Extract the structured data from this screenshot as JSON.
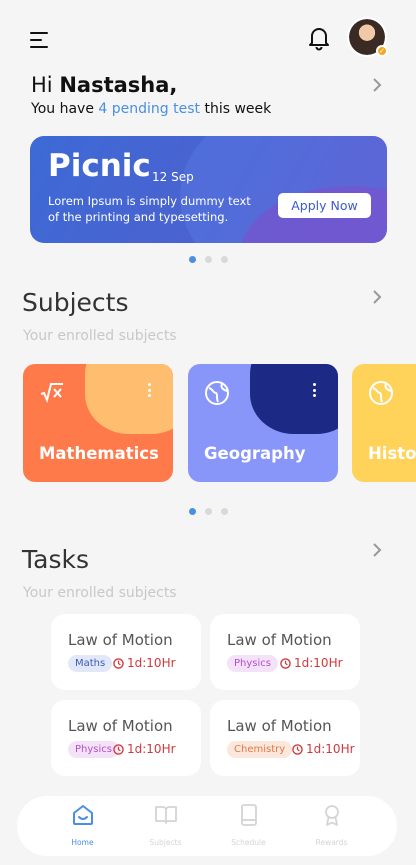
{
  "header": {
    "greeting_prefix": "Hi",
    "user_name": "Nastasha,",
    "pending_prefix": "You have",
    "pending_highlight": "4 pending test",
    "pending_suffix": "this week"
  },
  "banner": {
    "title": "Picnic",
    "date": "12 Sep",
    "description": "Lorem Ipsum is simply dummy text of the printing and typesetting.",
    "button_label": "Apply Now"
  },
  "subjects": {
    "title": "Subjects",
    "subtitle": "Your enrolled subjects",
    "cards": [
      {
        "label": "Mathematics",
        "icon": "square-root-icon",
        "color": "#ff7a4a",
        "corner": "#ffbd70"
      },
      {
        "label": "Geography",
        "icon": "globe-icon",
        "color": "#8896fa",
        "corner": "#1d2a85"
      },
      {
        "label": "History",
        "icon": "globe-icon",
        "color": "#ffd25a",
        "corner": "#ffd25a"
      }
    ]
  },
  "tasks": {
    "title": "Tasks",
    "subtitle": "Your enrolled subjects",
    "items": [
      {
        "title": "Law of Motion",
        "tag": "Maths",
        "time": "1d:10Hr"
      },
      {
        "title": "Law of Motion",
        "tag": "Physics",
        "time": "1d:10Hr"
      },
      {
        "title": "Law of Motion",
        "tag": "Physics",
        "time": "1d:10Hr"
      },
      {
        "title": "Law of Motion",
        "tag": "Chemistry",
        "time": "1d:10Hr"
      }
    ]
  },
  "nav": {
    "home": "Home",
    "subjects": "Subjects",
    "schedule": "Schedule",
    "rewards": "Rewards"
  },
  "colors": {
    "accent": "#4a8fe0",
    "time_red": "#d0393b"
  }
}
